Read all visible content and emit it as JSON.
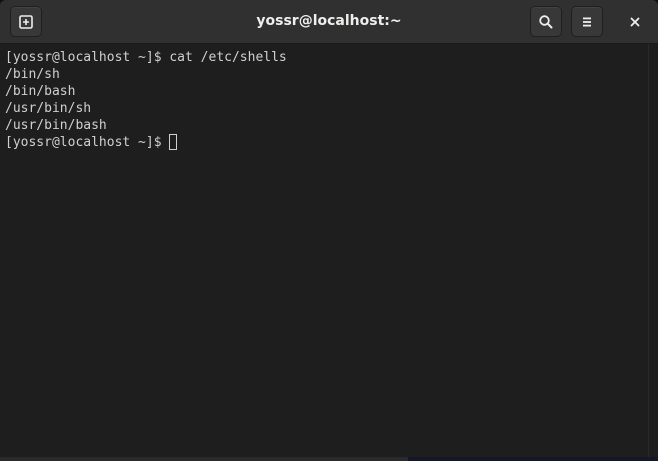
{
  "window": {
    "title": "yossr@localhost:~"
  },
  "titlebar": {
    "icons": {
      "new_tab": "new-tab-icon",
      "search": "search-icon",
      "menu": "hamburger-menu-icon",
      "close": "close-icon"
    }
  },
  "terminal": {
    "lines": [
      "[yossr@localhost ~]$ cat /etc/shells",
      "/bin/sh",
      "/bin/bash",
      "/usr/bin/sh",
      "/usr/bin/bash"
    ],
    "prompt": "[yossr@localhost ~]$ "
  },
  "colors": {
    "background": "#1e1e1e",
    "titlebar": "#303030",
    "text": "#d0d0d0",
    "title_text": "#eeeeec"
  }
}
